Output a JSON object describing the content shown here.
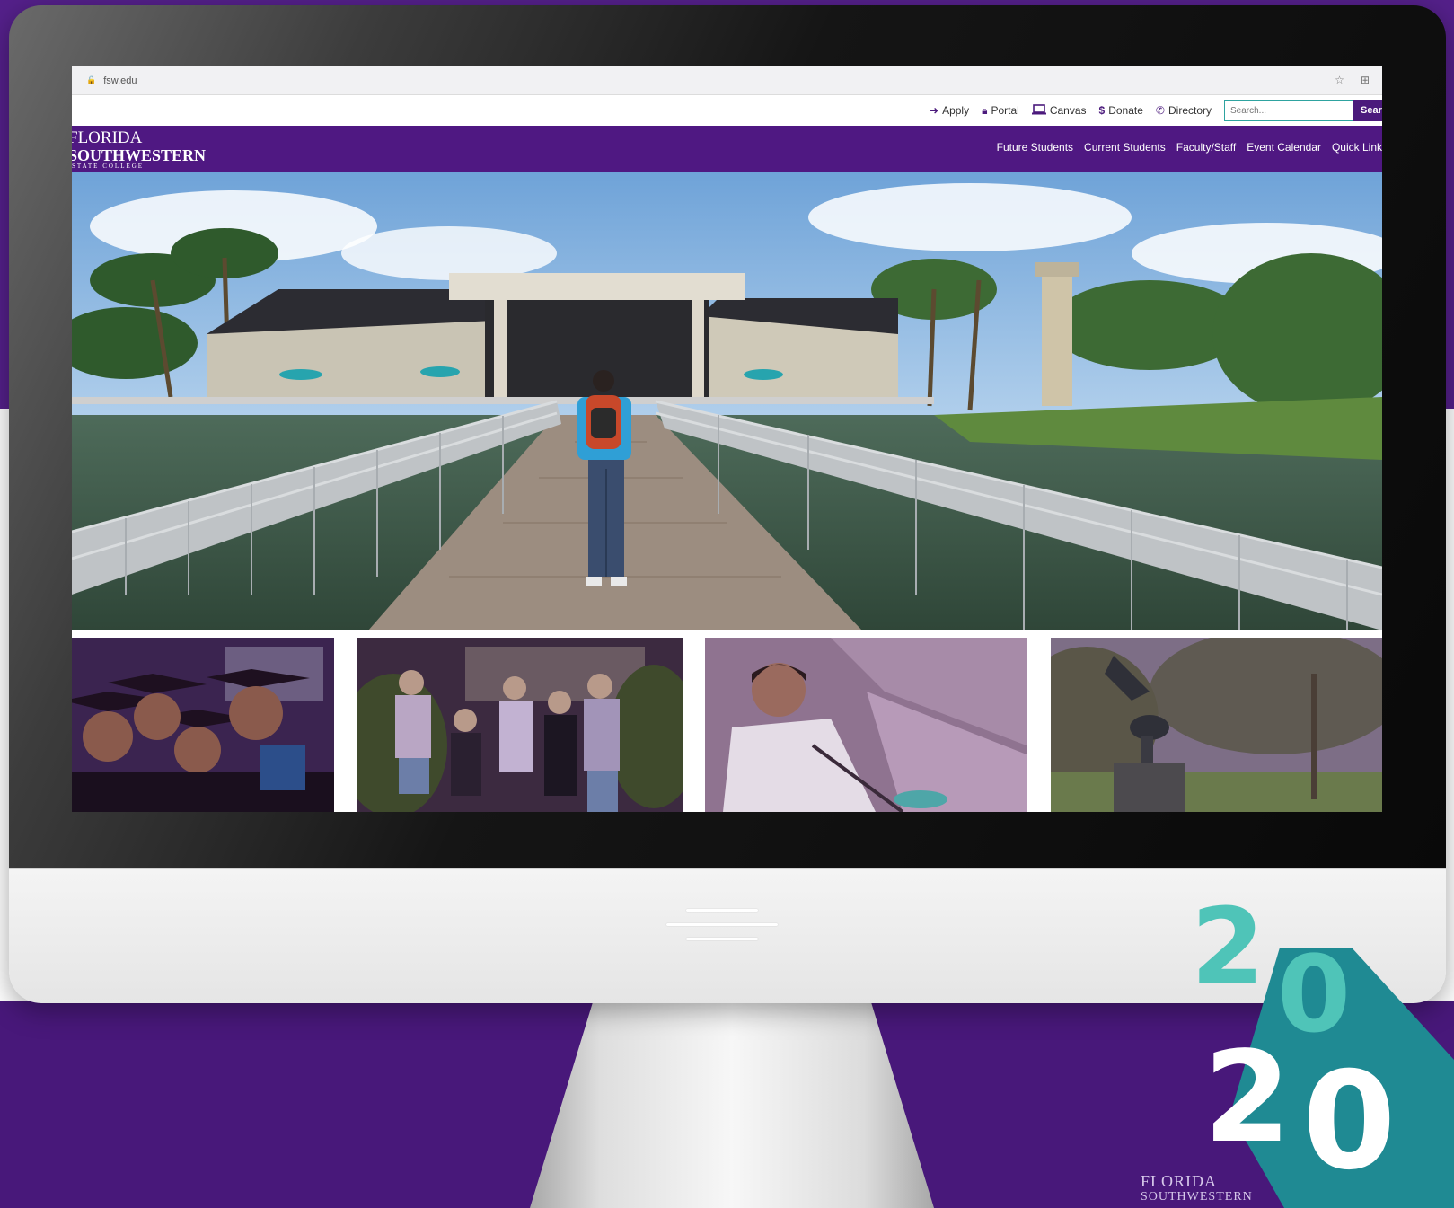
{
  "browser": {
    "url": "fsw.edu"
  },
  "utility_nav": {
    "links": [
      {
        "label": "Apply",
        "icon": "arrow-right-icon"
      },
      {
        "label": "Portal",
        "icon": "lock-icon"
      },
      {
        "label": "Canvas",
        "icon": "laptop-icon"
      },
      {
        "label": "Donate",
        "icon": "dollar-icon"
      },
      {
        "label": "Directory",
        "icon": "phone-icon"
      }
    ],
    "search_placeholder": "Search...",
    "search_button": "Search"
  },
  "logo": {
    "line1": "FLORIDA",
    "line2": "SOUTHWESTERN",
    "line3": "STATE COLLEGE"
  },
  "main_nav": {
    "items": [
      "Future Students",
      "Current Students",
      "Faculty/Staff",
      "Event Calendar",
      "Quick Links"
    ]
  },
  "badge": {
    "digit1": "2",
    "digit2": "0",
    "digit3": "2",
    "digit4": "0",
    "brand_line1": "FLORIDA",
    "brand_line2": "SOUTHWESTERN"
  },
  "colors": {
    "brand_purple": "#4f1882",
    "accent_teal": "#2ea3a0",
    "badge_teal_light": "#4fc4b8",
    "badge_teal_dark": "#1f8a93"
  }
}
